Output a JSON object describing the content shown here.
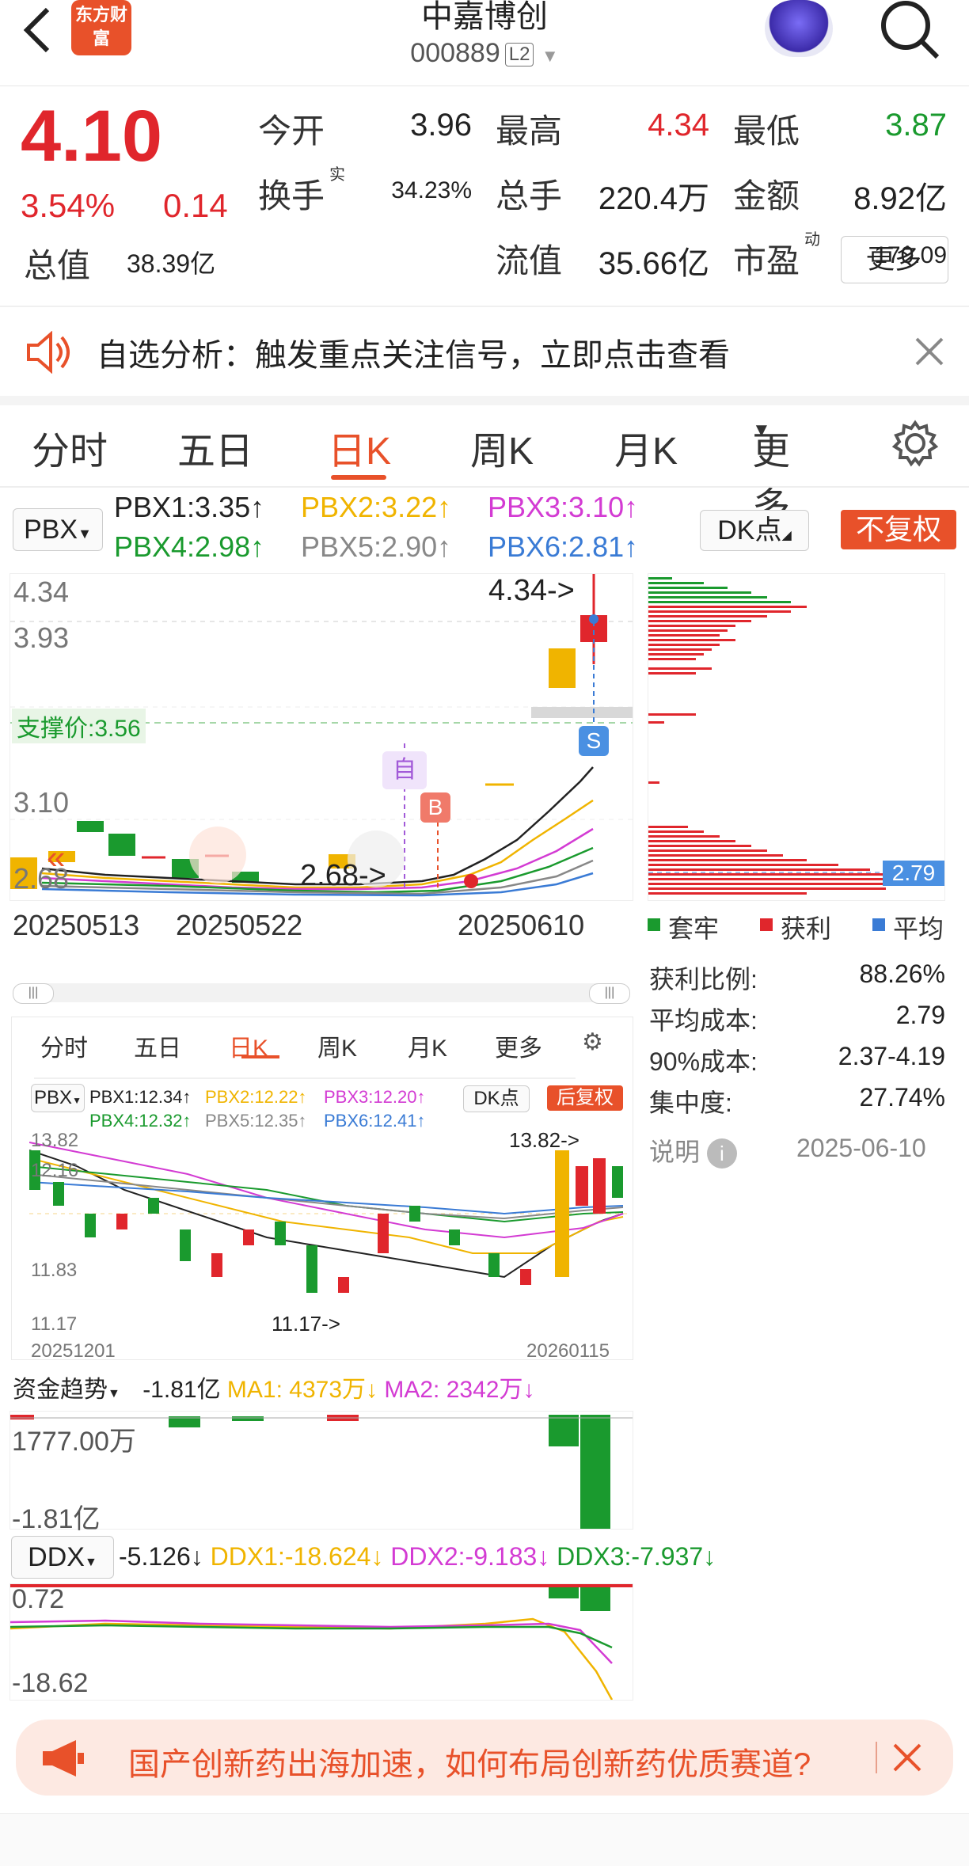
{
  "header": {
    "logo_text": "东方财富",
    "stock_name": "中嘉博创",
    "stock_code": "000889",
    "level_badge": "L2"
  },
  "quote": {
    "price": "4.10",
    "change_pct": "3.54%",
    "change_amt": "0.14",
    "rows": [
      [
        {
          "label": "今开",
          "value": "3.96",
          "color": "#222"
        },
        {
          "label": "最高",
          "value": "4.34",
          "color": "#e0262c"
        },
        {
          "label": "最低",
          "value": "3.87",
          "color": "#1a9a2e"
        }
      ],
      [
        {
          "label": "换手",
          "sup": "实",
          "value": "34.23%",
          "color": "#222"
        },
        {
          "label": "总手",
          "value": "220.4万",
          "color": "#222"
        },
        {
          "label": "金额",
          "value": "8.92亿",
          "color": "#222"
        }
      ],
      [
        {
          "label": "总值",
          "value": "38.39亿",
          "color": "#222"
        },
        {
          "label": "流值",
          "value": "35.66亿",
          "color": "#222"
        },
        {
          "label": "市盈",
          "sup": "动",
          "value": "-170.09",
          "color": "#222"
        }
      ]
    ],
    "more_label": "更多"
  },
  "alert": {
    "text": "自选分析：触发重点关注信号，立即点击查看"
  },
  "tabs": [
    "分时",
    "五日",
    "日K",
    "周K",
    "月K",
    "更多"
  ],
  "active_tab": "日K",
  "indicator": {
    "name": "PBX",
    "items": [
      {
        "label": "PBX1:3.35↑",
        "color": "#222"
      },
      {
        "label": "PBX2:3.22↑",
        "color": "#f0b400"
      },
      {
        "label": "PBX3:3.10↑",
        "color": "#d33bd3"
      },
      {
        "label": "PBX4:2.98↑",
        "color": "#1a9a2e"
      },
      {
        "label": "PBX5:2.90↑",
        "color": "#888888"
      },
      {
        "label": "PBX6:2.81↑",
        "color": "#3a7bd5"
      }
    ],
    "dk_label": "DK点",
    "adjust_label": "不复权"
  },
  "main_chart": {
    "y_labels": [
      "4.34",
      "3.93",
      "3.10",
      "2.68"
    ],
    "high_marker": "4.34->",
    "low_marker": "2.68->",
    "support_label": "支撑价:3.56",
    "x_labels": [
      "20250513",
      "20250522",
      "20250610"
    ],
    "marker_zi": "自",
    "marker_b": "B",
    "marker_s": "S"
  },
  "chip": {
    "price_tag": "2.79",
    "legend": [
      {
        "label": "套牢",
        "color": "#1a9a2e"
      },
      {
        "label": "获利",
        "color": "#e0262c"
      },
      {
        "label": "平均",
        "color": "#3a7bd5"
      }
    ],
    "stats": [
      {
        "label": "获利比例:",
        "value": "88.26%"
      },
      {
        "label": "平均成本:",
        "value": "2.79"
      },
      {
        "label": "90%成本:",
        "value": "2.37-4.19"
      },
      {
        "label": "集中度:",
        "value": "27.74%"
      }
    ],
    "note_label": "说明",
    "note_date": "2025-06-10"
  },
  "overlay": {
    "tabs": [
      "分时",
      "五日",
      "日K",
      "周K",
      "月K",
      "更多"
    ],
    "active_tab": "日K",
    "indicator_name": "PBX",
    "items": [
      {
        "label": "PBX1:12.34↑",
        "color": "#222"
      },
      {
        "label": "PBX2:12.22↑",
        "color": "#f0b400"
      },
      {
        "label": "PBX3:12.20↑",
        "color": "#d33bd3"
      },
      {
        "label": "PBX4:12.32↑",
        "color": "#1a9a2e"
      },
      {
        "label": "PBX5:12.35↑",
        "color": "#888888"
      },
      {
        "label": "PBX6:12.41↑",
        "color": "#3a7bd5"
      }
    ],
    "dk_label": "DK点",
    "adjust_label": "后复权",
    "y_labels": [
      "13.82",
      "12.16",
      "11.83",
      "11.17"
    ],
    "high_marker": "13.82->",
    "low_marker": "11.17->",
    "x_labels": [
      "20251201",
      "20260115"
    ]
  },
  "fund_flow": {
    "title": "资金趋势",
    "value": "-1.81亿",
    "ma1": "MA1: 4373万↓",
    "ma2": "MA2: 2342万↓",
    "y_top": "1777.00万",
    "y_bottom": "-1.81亿"
  },
  "ddx": {
    "name": "DDX",
    "value": "-5.126↓",
    "items": [
      {
        "label": "DDX1:-18.624↓",
        "color": "#f0b400"
      },
      {
        "label": "DDX2:-9.183↓",
        "color": "#d33bd3"
      },
      {
        "label": "DDX3:-7.937↓",
        "color": "#1a9a2e"
      }
    ],
    "y_top": "0.72",
    "y_bottom": "-18.62"
  },
  "promo": {
    "text": "国产创新药出海加速，如何布局创新药优质赛道?"
  }
}
